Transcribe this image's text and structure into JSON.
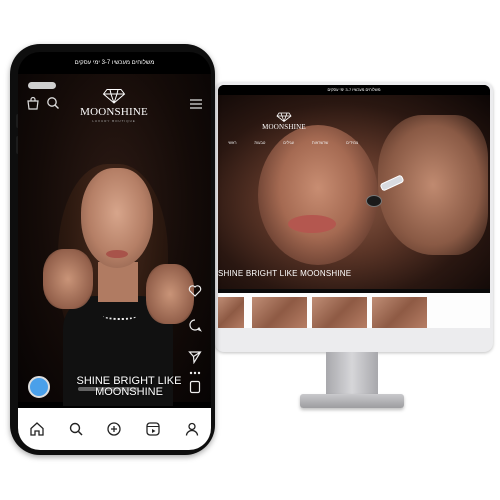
{
  "phone": {
    "announcement": "משלוחים מעכשיו 3-7 ימי עסקים",
    "logo": "MOONSHINE",
    "logo_sub": "LUXURY BOUTIQUE",
    "caption": "SHINE BRIGHT LIKE MOONSHINE",
    "tabbar": [
      {
        "icon": "home-icon"
      },
      {
        "icon": "search-icon"
      },
      {
        "icon": "add-icon"
      },
      {
        "icon": "reels-icon"
      },
      {
        "icon": "profile-icon"
      }
    ],
    "actions": [
      "heart-icon",
      "comment-icon",
      "send-icon",
      "more-icon",
      "save-icon"
    ]
  },
  "desktop": {
    "announcement": "משלוחים מעכשיו 3-7 ימי עסקים",
    "logo": "MOONSHINE",
    "nav": [
      "ראשי",
      "טבעות",
      "עגילים",
      "שרשראות",
      "צמידים"
    ],
    "tagline": "SHINE BRIGHT LIKE MOONSHINE"
  },
  "colors": {
    "accent_avatar": "#4aa0ea",
    "background": "#ffffff",
    "phone_frame": "#0e0e0e"
  }
}
